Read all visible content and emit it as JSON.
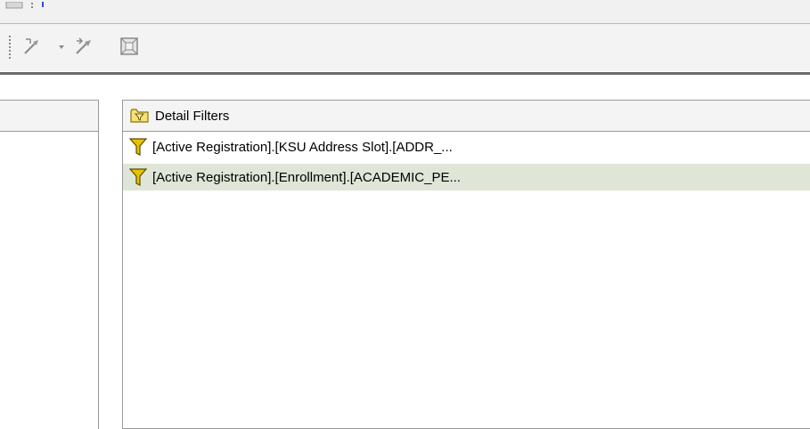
{
  "icons": {
    "insert_filter": "insert-filter-icon",
    "dropdown": "chevron-down-icon",
    "edit_filter": "edit-filter-icon",
    "grid": "grid-icon",
    "header_folder": "filter-folder-icon",
    "row_filter": "funnel-icon"
  },
  "colors": {
    "selected_row": "#dfe6d7",
    "funnel": "#e8c200"
  },
  "detail_filters": {
    "title": "Detail Filters",
    "items": [
      {
        "label": "[Active Registration].[KSU Address Slot].[ADDR_..."
      },
      {
        "label": "[Active Registration].[Enrollment].[ACADEMIC_PE..."
      }
    ]
  }
}
